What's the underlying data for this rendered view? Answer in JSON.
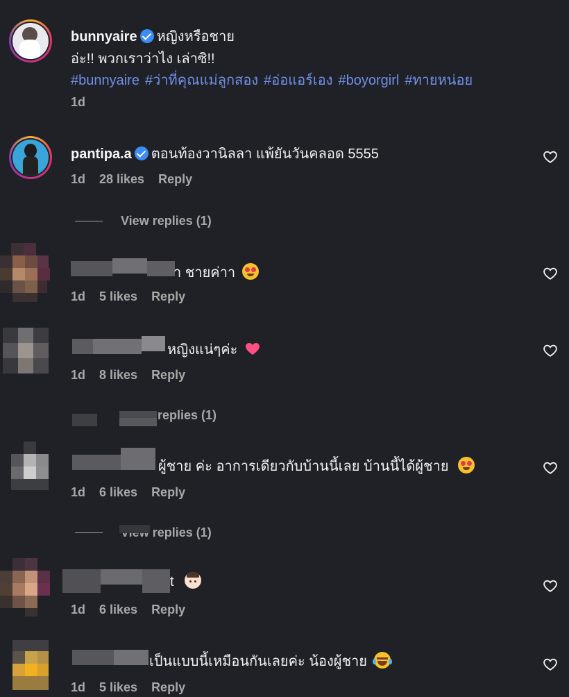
{
  "post": {
    "username": "bunnyaire",
    "title_text": "หญิงหรือชาย",
    "caption": "อ่ะ!! พวกเราว่าไง เล่าซิ!!",
    "hashtags": [
      "#bunnyaire",
      "#ว่าที่คุณแม่ลูกสอง",
      "#อ่อแอร์เอง",
      "#boyorgirl",
      "#ทายหน่อย"
    ],
    "time": "1d"
  },
  "comments": [
    {
      "username": "pantipa.a",
      "text": "ตอนท้องวานิลลา แพ้ยันวันคลอด 5555",
      "time": "1d",
      "likes": "28 likes",
      "reply": "Reply",
      "view_replies": "View replies (1)"
    },
    {
      "text": "า ชายค่าา",
      "emoji": "heart-eyes",
      "time": "1d",
      "likes": "5 likes",
      "reply": "Reply"
    },
    {
      "text": "หญิงแน่ๆค่ะ",
      "emoji": "pink-heart",
      "time": "1d",
      "likes": "8 likes",
      "reply": "Reply",
      "view_replies": "replies (1)"
    },
    {
      "text": "ผู้ชาย ค่ะ อาการเดียวกับบ้านนี้เลย บ้านนี้ได้ผู้ชาย",
      "emoji": "heart-eyes",
      "time": "1d",
      "likes": "6 likes",
      "reply": "Reply",
      "view_replies": "View replies (1)"
    },
    {
      "text": "t",
      "emoji": "boy-face",
      "time": "1d",
      "likes": "6 likes",
      "reply": "Reply"
    },
    {
      "text": "เป็นแบบนี้เหมือนกันเลยค่ะ น้องผู้ชาย",
      "emoji": "tears-of-joy",
      "time": "1d",
      "likes": "5 likes",
      "reply": "Reply"
    }
  ],
  "colors": {
    "background": "#202126",
    "hashtag": "#6f8fe8",
    "verified": "#3b8cf5",
    "muted": "#a8a8a8"
  }
}
